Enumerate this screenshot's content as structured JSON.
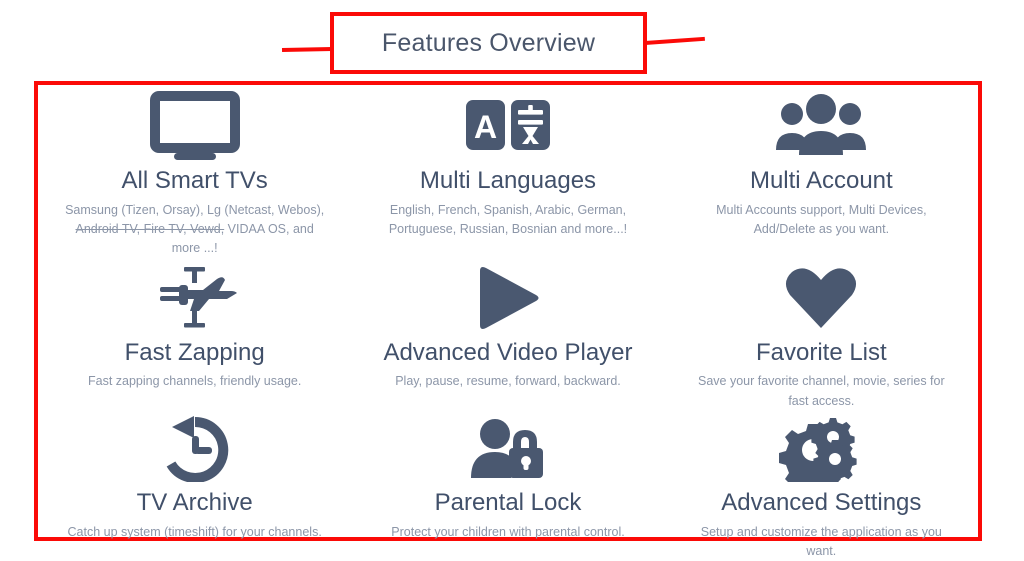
{
  "annotation": {
    "title": "Features Overview",
    "accent_color": "#fb0a07",
    "title_box_label": "features-overview-callout",
    "content_box_label": "features-grid-callout"
  },
  "theme": {
    "icon_color": "#4a5870",
    "heading_color": "#41506a",
    "body_color": "#8c96a8",
    "background": "#ffffff"
  },
  "features": [
    {
      "icon": "tv-icon",
      "title": "All Smart TVs",
      "desc_line1": "Samsung (Tizen, Orsay), Lg (Netcast, Webos),",
      "desc_struck": "Android TV, Fire TV, Vewd,",
      "desc_line2_rest": " VIDAA OS, and more",
      "desc_line3": "...!"
    },
    {
      "icon": "translate-icon",
      "title": "Multi Languages",
      "desc": "English, French, Spanish, Arabic, German, Portuguese, Russian, Bosnian and more...!"
    },
    {
      "icon": "users-group-icon",
      "title": "Multi Account",
      "desc": "Multi Accounts support, Multi Devices, Add/Delete as you want."
    },
    {
      "icon": "jet-plane-icon",
      "title": "Fast Zapping",
      "desc": "Fast zapping channels, friendly usage."
    },
    {
      "icon": "play-triangle-icon",
      "title": "Advanced Video Player",
      "desc": "Play, pause, resume, forward, backward."
    },
    {
      "icon": "heart-icon",
      "title": "Favorite List",
      "desc": "Save your favorite channel, movie, series for fast access."
    },
    {
      "icon": "clock-rewind-icon",
      "title": "TV Archive",
      "desc": "Catch up system (timeshift) for your channels."
    },
    {
      "icon": "person-lock-icon",
      "title": "Parental Lock",
      "desc": "Protect your children with parental control."
    },
    {
      "icon": "gears-icon",
      "title": "Advanced Settings",
      "desc": "Setup and customize the application as you want."
    }
  ],
  "translate_icon": {
    "left_glyph": "A",
    "right_glyph": "文"
  }
}
